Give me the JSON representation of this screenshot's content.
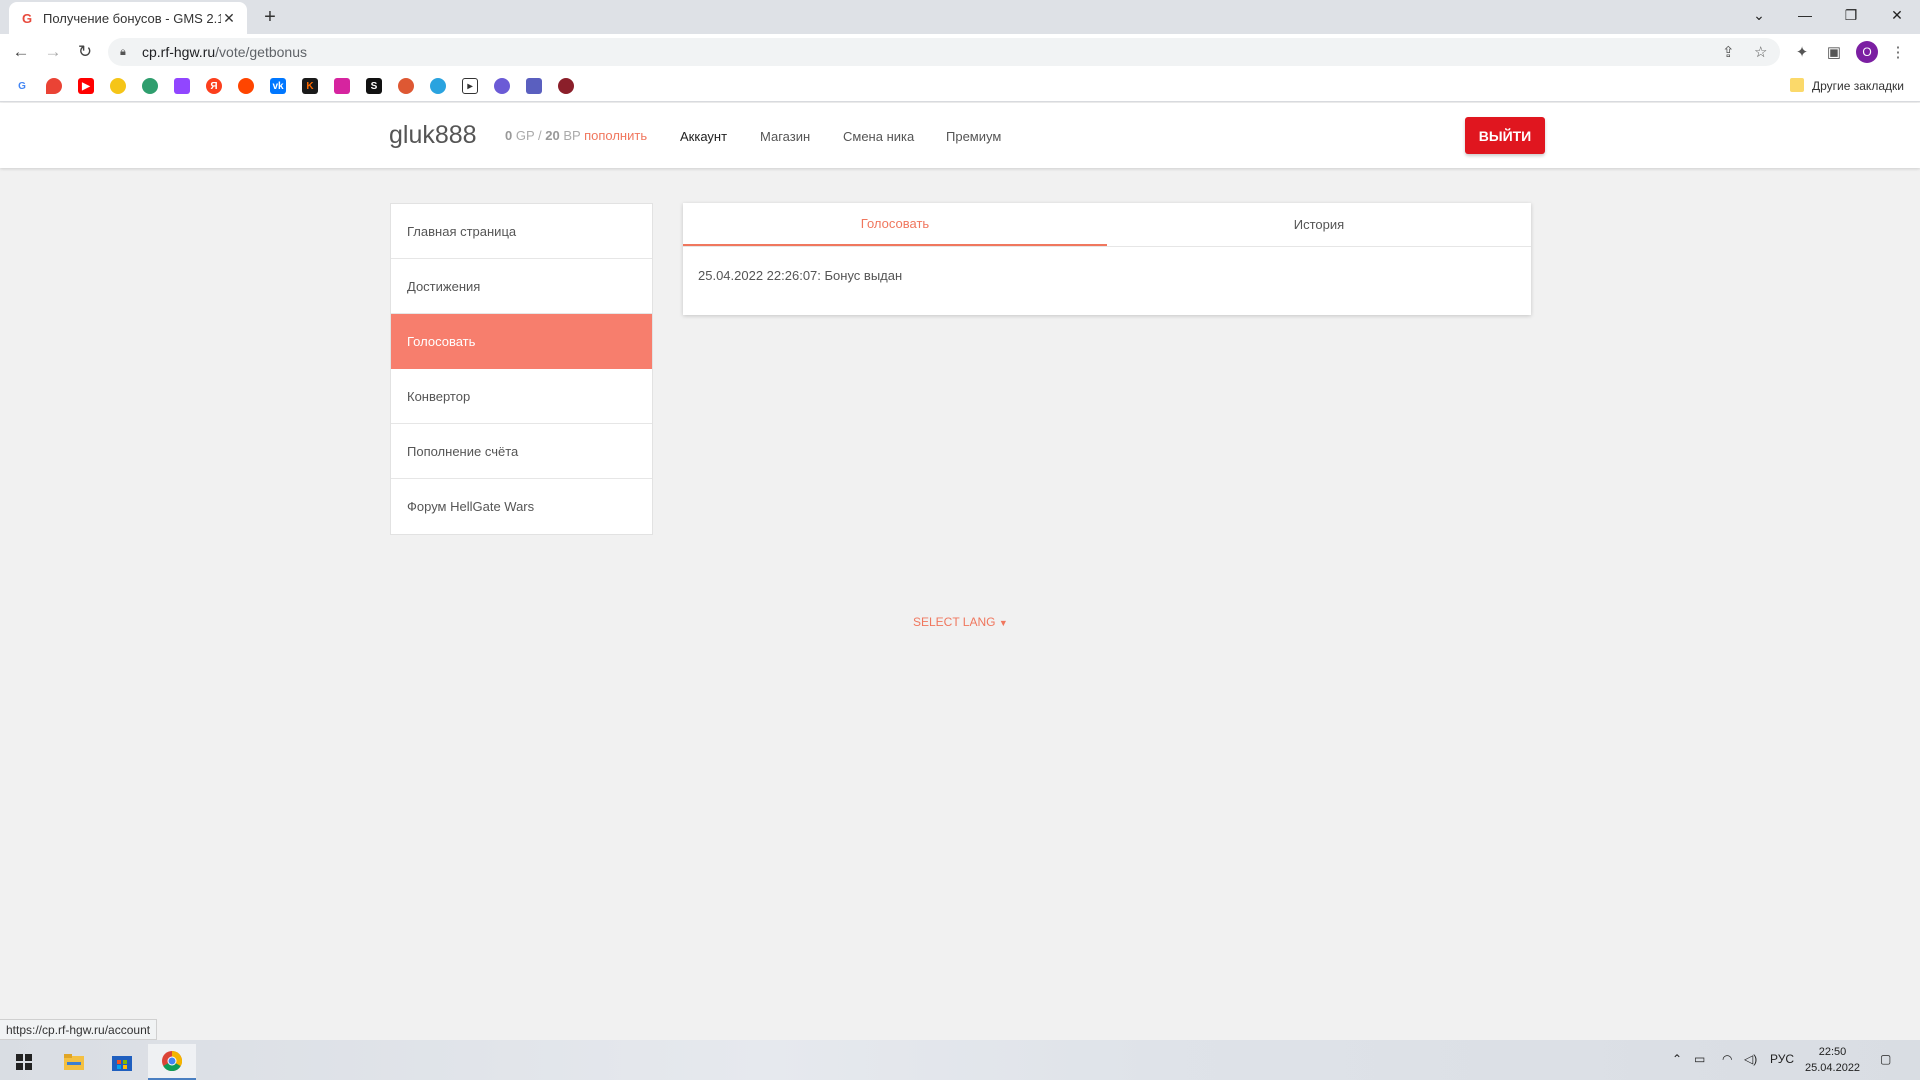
{
  "browser": {
    "tab_title": "Получение бонусов - GMS 2.1",
    "tab_favicon": "G",
    "url_host": "cp.rf-hgw.ru",
    "url_path": "/vote/getbonus",
    "profile_initial": "O",
    "bookmarks_other": "Другие закладки",
    "status_url": "https://cp.rf-hgw.ru/account"
  },
  "header": {
    "brand": "gluk888",
    "gp_value": "0",
    "gp_unit": "GP /",
    "bp_value": "20",
    "bp_unit": "BP",
    "topup": "пополнить",
    "menu": [
      "Аккаунт",
      "Магазин",
      "Смена ника",
      "Премиум"
    ],
    "logout": "ВЫЙТИ"
  },
  "sidebar": {
    "items": [
      {
        "label": "Главная страница"
      },
      {
        "label": "Достижения"
      },
      {
        "label": "Голосовать"
      },
      {
        "label": "Конвертор"
      },
      {
        "label": "Пополнение счёта"
      },
      {
        "label": "Форум HellGate Wars"
      }
    ],
    "active_index": 2
  },
  "card": {
    "tabs": [
      "Голосовать",
      "История"
    ],
    "message": "25.04.2022 22:26:07: Бонус выдан"
  },
  "footer": {
    "select_lang": "SELECT LANG"
  },
  "taskbar": {
    "lang": "РУС",
    "time": "22:50",
    "date": "25.04.2022"
  },
  "colors": {
    "accent": "#f0775e",
    "active_sidebar": "#f77e6d",
    "logout": "#e0161f"
  }
}
